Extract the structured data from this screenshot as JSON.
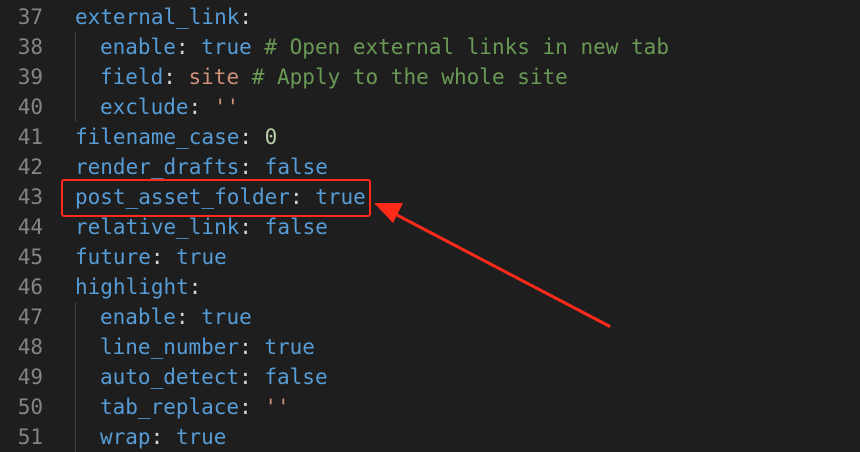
{
  "colors": {
    "background": "#1e1e1e",
    "line_number": "#858585",
    "key": "#569cd6",
    "keyword": "#569cd6",
    "string": "#ce9178",
    "number": "#b5cea8",
    "comment": "#6a9955",
    "annotation": "#ff2a1a"
  },
  "lines": [
    {
      "num": "37",
      "indent": false,
      "key": "external_link",
      "sep": ":",
      "value": "",
      "value_type": "",
      "comment": ""
    },
    {
      "num": "38",
      "indent": true,
      "key": "enable",
      "sep": ": ",
      "value": "true",
      "value_type": "kw",
      "comment": " # Open external links in new tab"
    },
    {
      "num": "39",
      "indent": true,
      "key": "field",
      "sep": ": ",
      "value": "site",
      "value_type": "str",
      "comment": " # Apply to the whole site"
    },
    {
      "num": "40",
      "indent": true,
      "key": "exclude",
      "sep": ": ",
      "value": "''",
      "value_type": "str",
      "comment": ""
    },
    {
      "num": "41",
      "indent": false,
      "key": "filename_case",
      "sep": ": ",
      "value": "0",
      "value_type": "num",
      "comment": ""
    },
    {
      "num": "42",
      "indent": false,
      "key": "render_drafts",
      "sep": ": ",
      "value": "false",
      "value_type": "kw",
      "comment": ""
    },
    {
      "num": "43",
      "indent": false,
      "key": "post_asset_folder",
      "sep": ": ",
      "value": "true",
      "value_type": "kw",
      "comment": ""
    },
    {
      "num": "44",
      "indent": false,
      "key": "relative_link",
      "sep": ": ",
      "value": "false",
      "value_type": "kw",
      "comment": ""
    },
    {
      "num": "45",
      "indent": false,
      "key": "future",
      "sep": ": ",
      "value": "true",
      "value_type": "kw",
      "comment": ""
    },
    {
      "num": "46",
      "indent": false,
      "key": "highlight",
      "sep": ":",
      "value": "",
      "value_type": "",
      "comment": ""
    },
    {
      "num": "47",
      "indent": true,
      "key": "enable",
      "sep": ": ",
      "value": "true",
      "value_type": "kw",
      "comment": ""
    },
    {
      "num": "48",
      "indent": true,
      "key": "line_number",
      "sep": ": ",
      "value": "true",
      "value_type": "kw",
      "comment": ""
    },
    {
      "num": "49",
      "indent": true,
      "key": "auto_detect",
      "sep": ": ",
      "value": "false",
      "value_type": "kw",
      "comment": ""
    },
    {
      "num": "50",
      "indent": true,
      "key": "tab_replace",
      "sep": ": ",
      "value": "''",
      "value_type": "str",
      "comment": ""
    },
    {
      "num": "51",
      "indent": true,
      "key": "wrap",
      "sep": ": ",
      "value": "true",
      "value_type": "kw",
      "comment": ""
    }
  ],
  "annotation": {
    "highlighted_line": "43"
  }
}
